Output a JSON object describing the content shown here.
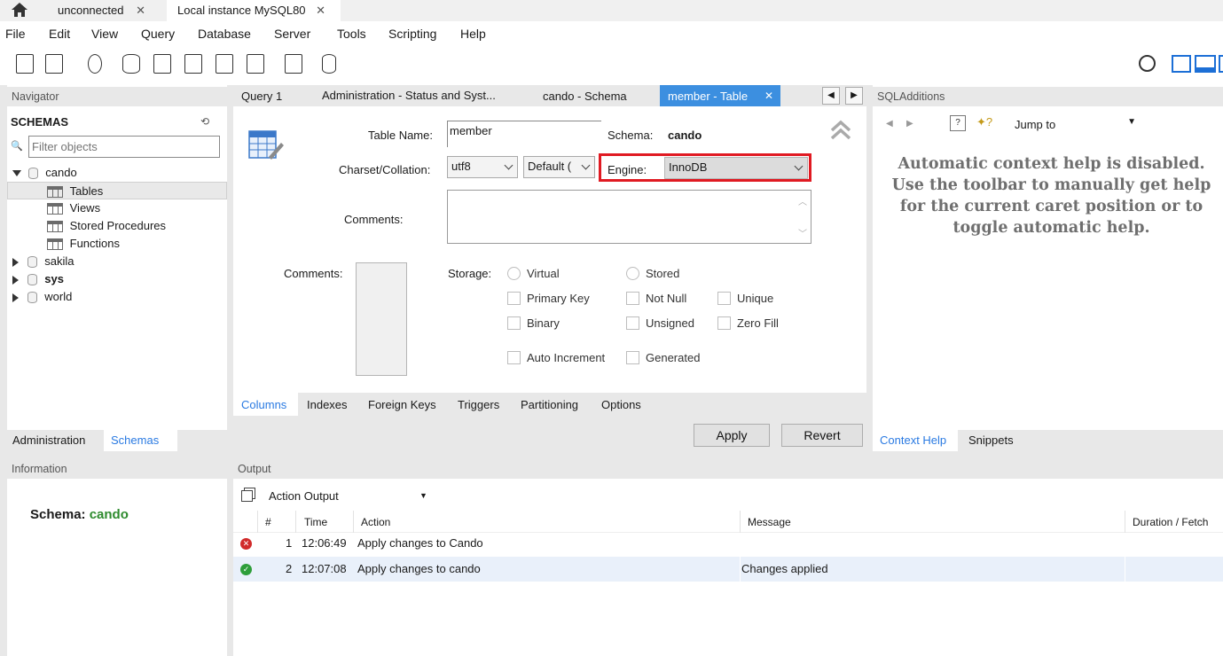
{
  "tabs": [
    {
      "label": "unconnected"
    },
    {
      "label": "Local instance MySQL80"
    }
  ],
  "menu": [
    "File",
    "Edit",
    "View",
    "Query",
    "Database",
    "Server",
    "Tools",
    "Scripting",
    "Help"
  ],
  "navigator": {
    "header": "Navigator",
    "schemas_title": "SCHEMAS",
    "filter_placeholder": "Filter objects",
    "tree": {
      "cando": "cando",
      "tables": "Tables",
      "views": "Views",
      "stored_procedures": "Stored Procedures",
      "functions": "Functions",
      "sakila": "sakila",
      "sys": "sys",
      "world": "world"
    },
    "bottom_tabs": [
      "Administration",
      "Schemas"
    ]
  },
  "information": {
    "header": "Information",
    "schema_label": "Schema:",
    "schema_value": "cando"
  },
  "editor_tabs": [
    "Query 1",
    "Administration - Status and Syst...",
    "cando - Schema",
    "member - Table"
  ],
  "table_editor": {
    "table_name_label": "Table Name:",
    "table_name_value": "member",
    "schema_label": "Schema:",
    "schema_value": "cando",
    "charset_label": "Charset/Collation:",
    "charset_value": "utf8",
    "collation_value": "Default (",
    "engine_label": "Engine:",
    "engine_value": "InnoDB",
    "comments_label": "Comments:",
    "column_comments_label": "Comments:",
    "storage_label": "Storage:",
    "storage_virtual": "Virtual",
    "storage_stored": "Stored",
    "primary_key": "Primary Key",
    "not_null": "Not Null",
    "unique": "Unique",
    "binary": "Binary",
    "unsigned": "Unsigned",
    "zero_fill": "Zero Fill",
    "auto_increment": "Auto Increment",
    "generated": "Generated",
    "bottom_tabs": [
      "Columns",
      "Indexes",
      "Foreign Keys",
      "Triggers",
      "Partitioning",
      "Options"
    ],
    "apply_label": "Apply",
    "revert_label": "Revert"
  },
  "sql_additions": {
    "header": "SQLAdditions",
    "jump_to": "Jump to",
    "help_text": "Automatic context help is disabled. Use the toolbar to manually get help for the current caret position or to toggle automatic help.",
    "bottom_tabs": [
      "Context Help",
      "Snippets"
    ]
  },
  "output": {
    "header": "Output",
    "selector": "Action Output",
    "columns": [
      "#",
      "Time",
      "Action",
      "Message",
      "Duration / Fetch"
    ],
    "rows": [
      {
        "status": "error",
        "num": "1",
        "time": "12:06:49",
        "action": "Apply changes to Cando",
        "message": "",
        "duration": ""
      },
      {
        "status": "ok",
        "num": "2",
        "time": "12:07:08",
        "action": "Apply changes to cando",
        "message": "Changes applied",
        "duration": ""
      }
    ]
  },
  "colors": {
    "accent_blue": "#2a7ae2",
    "active_tab": "#3c8fe0",
    "highlight_red": "#e01a22",
    "schema_green": "#2e8b2e"
  }
}
